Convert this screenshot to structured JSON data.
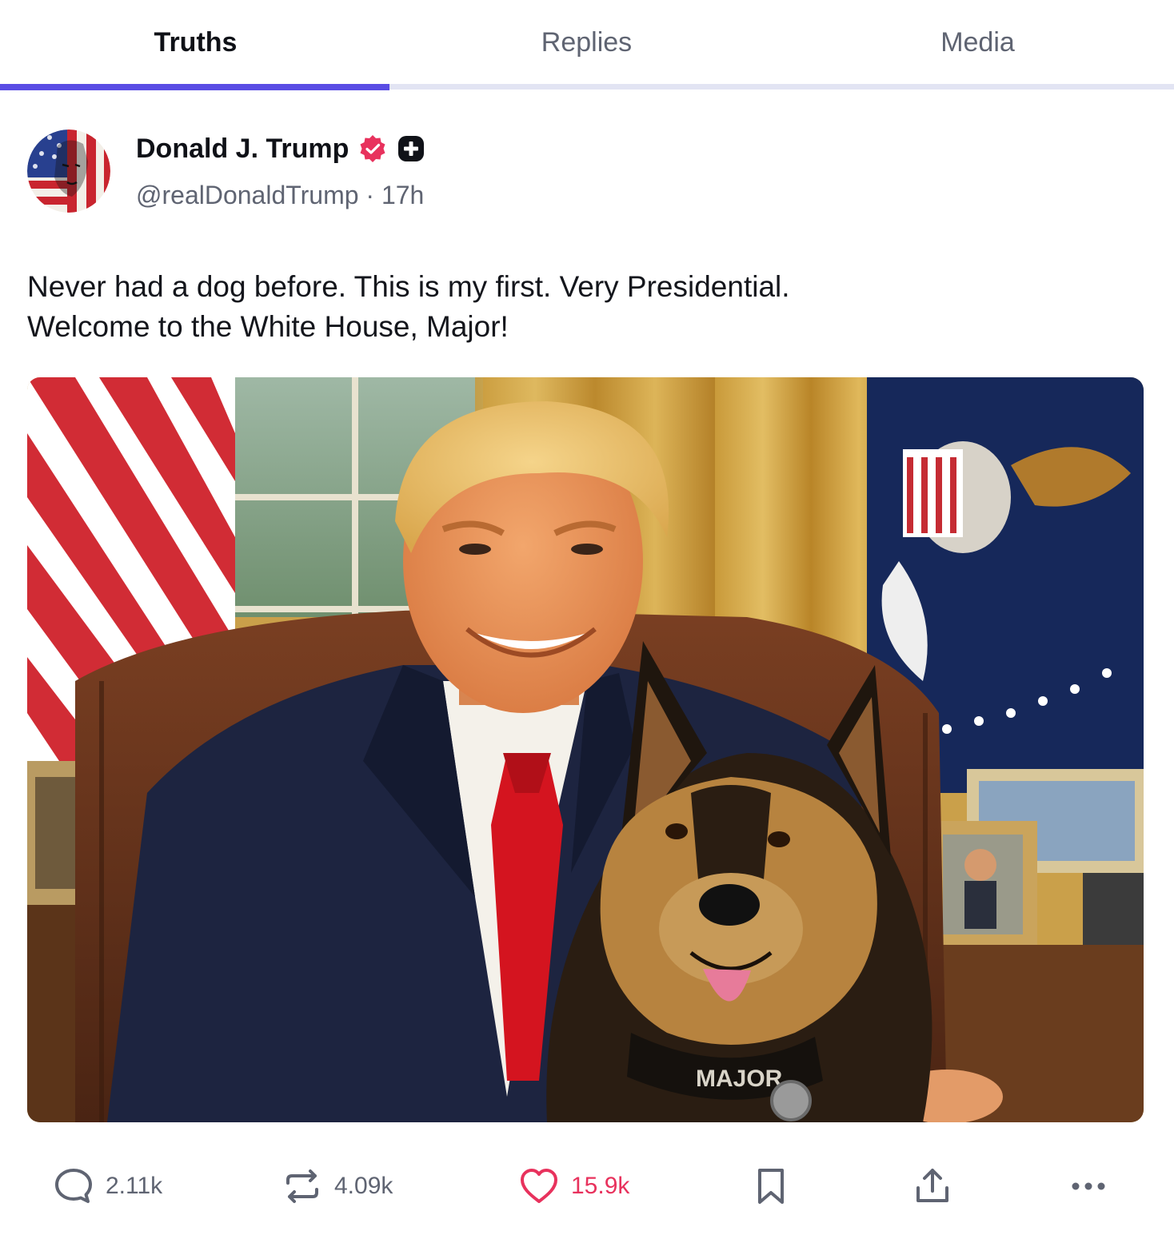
{
  "tabs": [
    {
      "label": "Truths",
      "active": true
    },
    {
      "label": "Replies",
      "active": false
    },
    {
      "label": "Media",
      "active": false
    }
  ],
  "post": {
    "author_name": "Donald J. Trump",
    "handle": "@realDonaldTrump",
    "separator": "·",
    "time": "17h",
    "text_lines": [
      "Never had a dog before. This is my first. Very Presidential.",
      "Welcome to the White House, Major!"
    ],
    "image_collar_text": "MAJOR",
    "icons": {
      "verified": "verified-badge-icon",
      "plus": "truth-plus-icon"
    }
  },
  "actions": {
    "reply": {
      "icon": "reply-icon",
      "count": "2.11k"
    },
    "retruth": {
      "icon": "retruth-icon",
      "count": "4.09k"
    },
    "like": {
      "icon": "heart-icon",
      "count": "15.9k",
      "active": true
    },
    "bookmark": {
      "icon": "bookmark-icon"
    },
    "share": {
      "icon": "share-icon"
    },
    "more": {
      "icon": "more-icon"
    }
  },
  "colors": {
    "accent": "#5a4de4",
    "tab_track": "#e2e4f3",
    "like": "#e8325d",
    "verified": "#e8325d",
    "muted": "#5f6472"
  }
}
